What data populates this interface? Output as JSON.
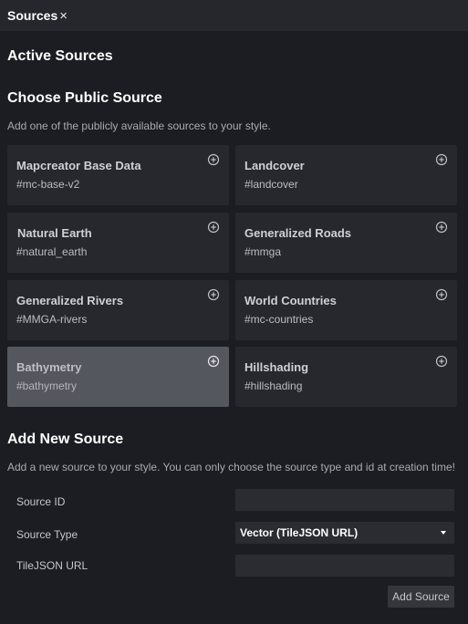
{
  "window": {
    "title": "Sources",
    "close_glyph": "×"
  },
  "active": {
    "heading": "Active Sources"
  },
  "public": {
    "heading": "Choose Public Source",
    "description": "Add one of the publicly available sources to your style.",
    "sources": [
      {
        "name": "Mapcreator Base Data",
        "id": "#mc-base-v2",
        "icon": "plus-circle-icon"
      },
      {
        "name": "Landcover",
        "id": "#landcover",
        "icon": "plus-circle-icon"
      },
      {
        "name": "Natural Earth",
        "id": "#natural_earth",
        "icon": "plus-circle-icon"
      },
      {
        "name": "Generalized Roads",
        "id": "#mmga",
        "icon": "plus-circle-icon"
      },
      {
        "name": "Generalized Rivers",
        "id": "#MMGA-rivers",
        "icon": "plus-circle-icon"
      },
      {
        "name": "World Countries",
        "id": "#mc-countries",
        "icon": "plus-circle-icon"
      },
      {
        "name": "Bathymetry",
        "id": "#bathymetry",
        "icon": "plus-circle-icon",
        "selected": true
      },
      {
        "name": "Hillshading",
        "id": "#hillshading",
        "icon": "plus-circle-icon"
      }
    ]
  },
  "new_source": {
    "heading": "Add New Source",
    "description": "Add a new source to your style. You can only choose the source type and id at creation time!",
    "source_id_label": "Source ID",
    "source_id_value": "",
    "source_type_label": "Source Type",
    "source_type_value": "Vector (TileJSON URL)",
    "tilejson_label": "TileJSON URL",
    "tilejson_value": "",
    "add_button": "Add Source"
  },
  "colors": {
    "background": "#1c1d22",
    "card": "#27282d",
    "card_selected": "#55575f",
    "input": "#2b2c31"
  }
}
